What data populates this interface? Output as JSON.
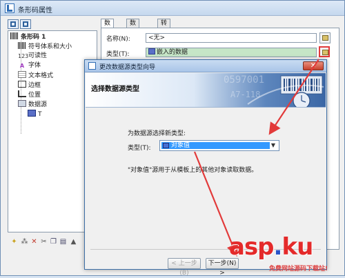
{
  "window": {
    "title": "条形码属性"
  },
  "tree": {
    "items": [
      {
        "label": "条形码 1",
        "icon": "barcode-icon"
      },
      {
        "label": "符号体系和大小",
        "icon": "barcode-small-icon"
      },
      {
        "label": "可读性",
        "icon": "readability-icon",
        "icon_text": "123"
      },
      {
        "label": "字体",
        "icon": "font-icon",
        "icon_text": "A"
      },
      {
        "label": "文本格式",
        "icon": "text-format-icon"
      },
      {
        "label": "边框",
        "icon": "border-icon"
      },
      {
        "label": "位置",
        "icon": "position-icon"
      },
      {
        "label": "数据源",
        "icon": "datasource-icon"
      },
      {
        "label": "T",
        "icon": "embedded-data-icon"
      }
    ]
  },
  "tabs": [
    "数据源",
    "数据类型",
    "转换"
  ],
  "properties": {
    "name_label": "名称(N):",
    "name_value": "<无>",
    "type_label": "类型(T):",
    "type_value": "嵌入的数据"
  },
  "wizard": {
    "title": "更改数据源类型向导",
    "heading": "选择数据源类型",
    "banner_digits_a": "0597001",
    "banner_digits_b": "A7-118",
    "prompt": "为数据源选择新类型:",
    "type_label": "类型(T):",
    "selected_type": "对象值",
    "description": "\"对象值\"源用于从模板上的其他对象读取数据。",
    "back_button": "< 上一步(B)",
    "next_button": "下一步(N) >",
    "close_glyph": "✕"
  },
  "watermark": {
    "main_a": "asp",
    "main_b": "ku",
    "sub": "免费网站源码下载站!"
  },
  "colors": {
    "highlight": "#e23a3a",
    "selection": "#3399ff",
    "embedded_bg": "#c6e6c7"
  }
}
